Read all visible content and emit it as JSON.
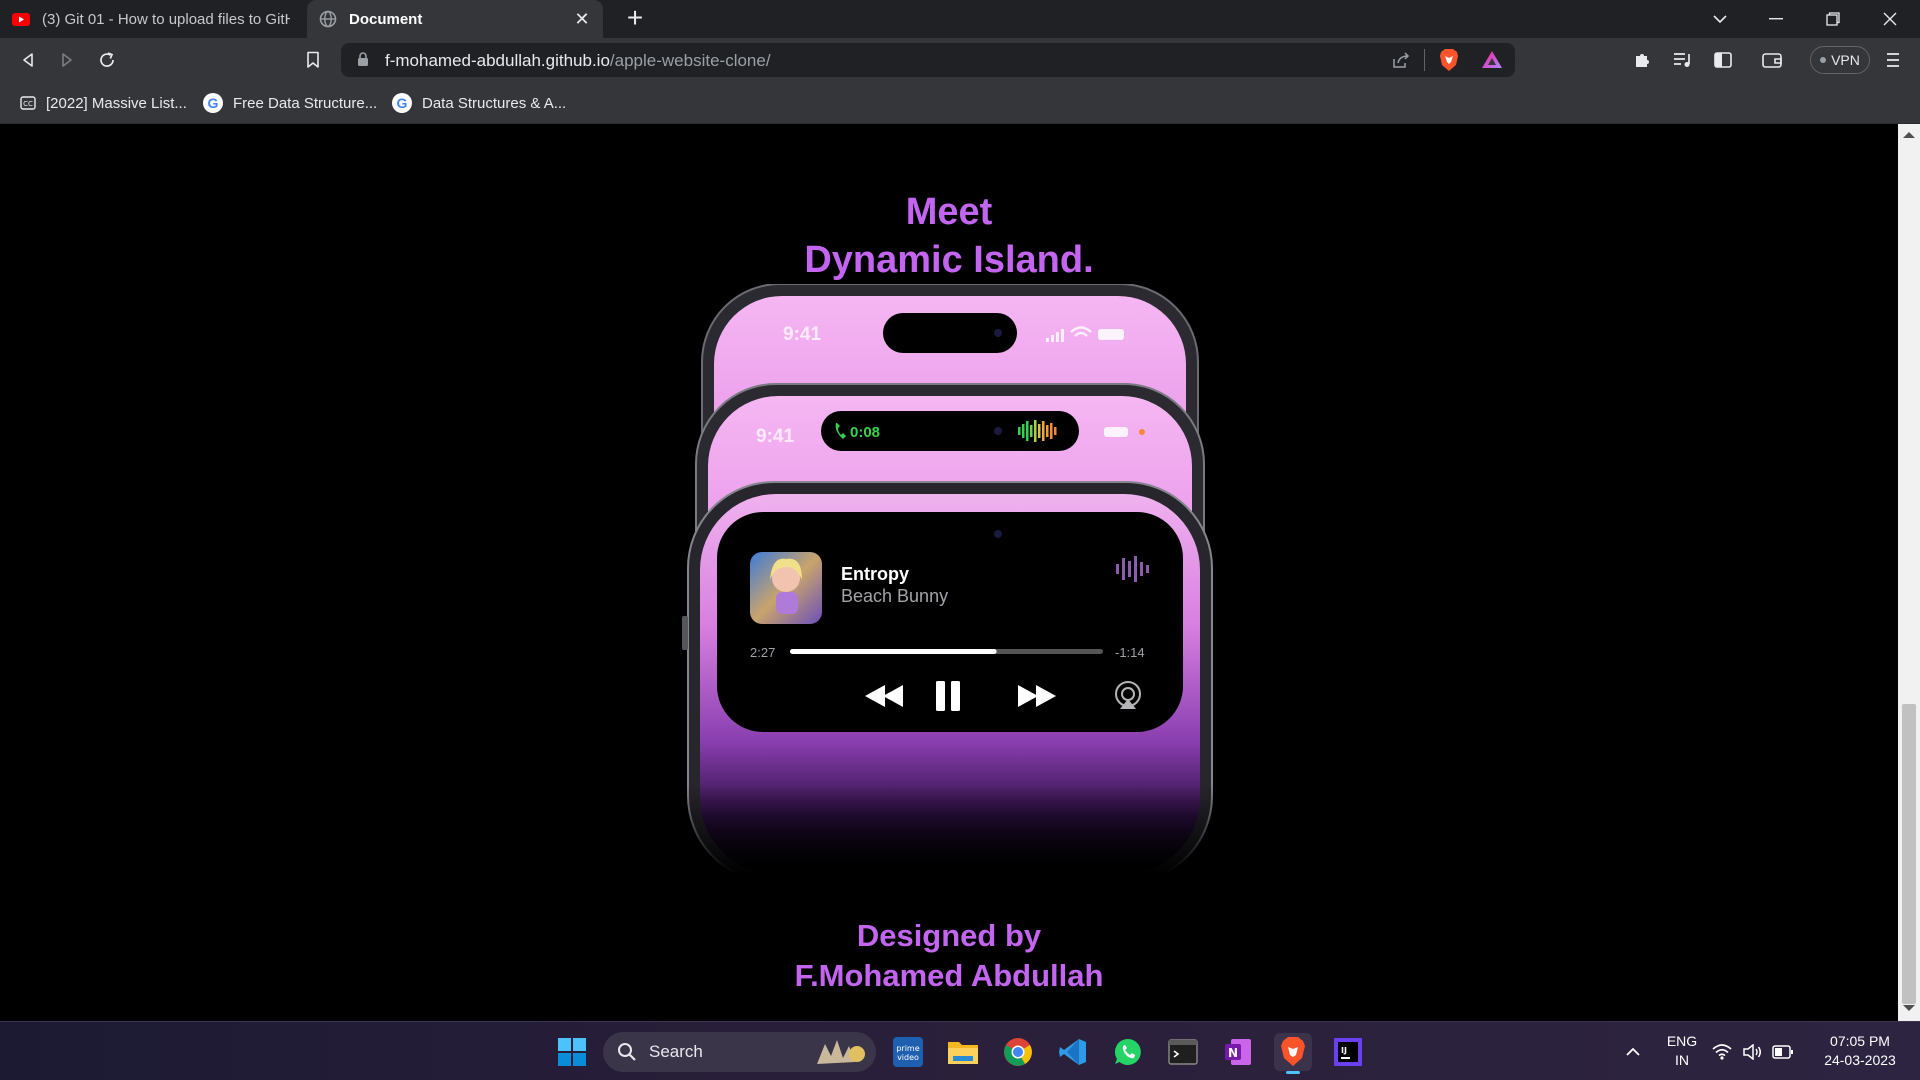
{
  "browser": {
    "tabs": [
      {
        "title": "(3) Git 01 - How to upload files to GitH",
        "favicon": "youtube-icon",
        "active": false
      },
      {
        "title": "Document",
        "favicon": "globe-icon",
        "active": true
      }
    ],
    "address": {
      "domain": "f-mohamed-abdullah.github.io",
      "path": "/apple-website-clone/"
    },
    "vpn_label": "VPN",
    "bookmarks": [
      {
        "label": "[2022] Massive List...",
        "icon": "cc-icon"
      },
      {
        "label": "Free Data Structure...",
        "icon": "google-icon"
      },
      {
        "label": "Data Structures & A...",
        "icon": "google-icon"
      }
    ]
  },
  "page": {
    "headline_line1": "Meet",
    "headline_line2": "Dynamic Island.",
    "phones": {
      "back_time": "9:41",
      "middle_time": "9:41",
      "call_timer": "0:08",
      "track_title": "Entropy",
      "track_artist": "Beach Bunny",
      "elapsed": "2:27",
      "remaining": "-1:14",
      "progress": 0.66
    },
    "credit_line1": "Designed by",
    "credit_line2": "F.Mohamed Abdullah",
    "accent_color": "#c365f0"
  },
  "taskbar": {
    "search_label": "Search",
    "apps": [
      "prime-video-icon",
      "file-explorer-icon",
      "chrome-icon",
      "vscode-icon",
      "whatsapp-icon",
      "terminal-icon",
      "onenote-icon",
      "brave-icon",
      "intellij-icon"
    ],
    "lang_line1": "ENG",
    "lang_line2": "IN",
    "time": "07:05 PM",
    "date": "24-03-2023"
  }
}
